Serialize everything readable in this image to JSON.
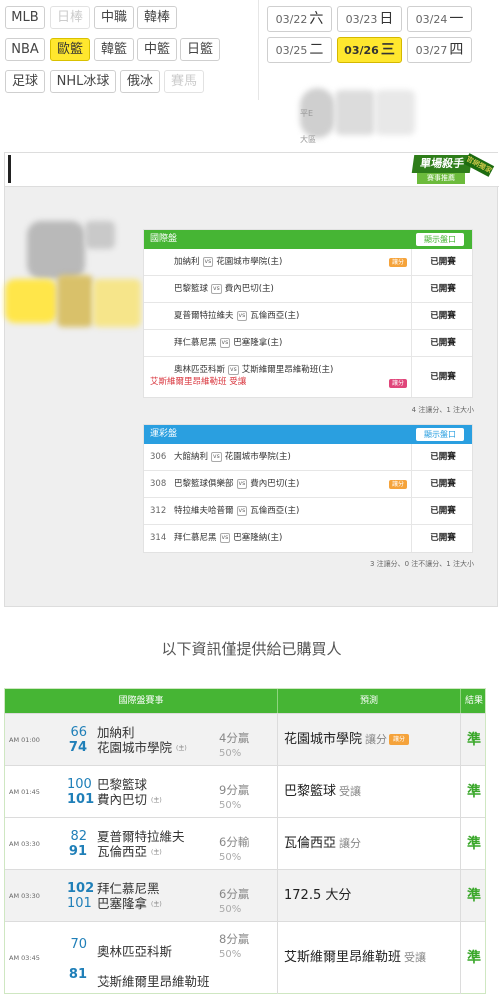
{
  "league_tabs": [
    {
      "label": "MLB",
      "state": "normal"
    },
    {
      "label": "日棒",
      "state": "disabled"
    },
    {
      "label": "中職",
      "state": "normal"
    },
    {
      "label": "韓棒",
      "state": "normal"
    },
    {
      "label": "NBA",
      "state": "normal"
    },
    {
      "label": "歐籃",
      "state": "selected"
    },
    {
      "label": "韓籃",
      "state": "normal"
    },
    {
      "label": "中籃",
      "state": "normal"
    },
    {
      "label": "日籃",
      "state": "normal"
    },
    {
      "label": "足球",
      "state": "normal"
    },
    {
      "label": "NHL冰球",
      "state": "normal"
    },
    {
      "label": "俄冰",
      "state": "normal"
    },
    {
      "label": "賽馬",
      "state": "disabled"
    }
  ],
  "dates": [
    {
      "md": "03/22",
      "dow": "六",
      "selected": false
    },
    {
      "md": "03/23",
      "dow": "日",
      "selected": false
    },
    {
      "md": "03/24",
      "dow": "一",
      "selected": false
    },
    {
      "md": "03/25",
      "dow": "二",
      "selected": false
    },
    {
      "md": "03/26",
      "dow": "三",
      "selected": true
    },
    {
      "md": "03/27",
      "dow": "四",
      "selected": false
    }
  ],
  "blurred_top": {
    "line1": "平E",
    "line2": "大區"
  },
  "banner": {
    "badge_main": "單場殺手",
    "badge_sub": "賽事推薦",
    "badge_ribbon": "官網獨家",
    "intl": {
      "title": "國際盤",
      "button": "顯示盤口",
      "rows": [
        {
          "away": "加納利",
          "home": "花園城市學院(主)",
          "tag": "讓分",
          "status": "已開賽"
        },
        {
          "away": "巴黎籃球",
          "home": "費內巴切(主)",
          "tag": "",
          "status": "已開賽"
        },
        {
          "away": "夏普爾特拉維夫",
          "home": "瓦倫西亞(主)",
          "tag": "",
          "status": "已開賽"
        },
        {
          "away": "拜仁慕尼黑",
          "home": "巴塞隆拿(主)",
          "tag": "",
          "status": "已開賽"
        },
        {
          "away": "奧林匹亞科斯",
          "home": "艾斯維爾里昂維勒班(主)",
          "extra": "艾斯維爾里昂維勒班 受讓",
          "tag": "讓分",
          "status": "已開賽"
        }
      ],
      "note": "4 注讓分、1 注大小"
    },
    "lottery": {
      "title": "運彩盤",
      "button": "顯示盤口",
      "rows": [
        {
          "num": "306",
          "away": "大館納利",
          "home": "花園城市學院(主)",
          "tag": "",
          "status": "已開賽"
        },
        {
          "num": "308",
          "away": "巴黎籃球俱樂部",
          "home": "費內巴切(主)",
          "tag": "讓分",
          "status": "已開賽"
        },
        {
          "num": "312",
          "away": "特拉維夫哈普爾",
          "home": "瓦倫西亞(主)",
          "tag": "",
          "status": "已開賽"
        },
        {
          "num": "314",
          "away": "拜仁慕尼黑",
          "home": "巴塞隆納(主)",
          "tag": "",
          "status": "已開賽"
        }
      ],
      "note": "3 注讓分、0 注不讓分、1 注大小"
    }
  },
  "notice": "以下資訊僅提供給已購買人",
  "table": {
    "headers": {
      "match": "國際盤賽事",
      "prediction": "預測",
      "result": "結果"
    },
    "home_mark": "(主)",
    "rows": [
      {
        "time": "AM 01:00",
        "away_num": "66",
        "home_num": "74",
        "away": "加納利",
        "home": "花園城市學院",
        "res": "4分贏",
        "pct": "50%",
        "pick": "花園城市學院",
        "pick_sub": "讓分",
        "pick_tag": "讓分",
        "outcome": "準"
      },
      {
        "time": "AM 01:45",
        "away_num": "100",
        "home_num": "101",
        "away": "巴黎籃球",
        "home": "費內巴切",
        "res": "9分贏",
        "pct": "50%",
        "pick": "巴黎籃球",
        "pick_sub": "受讓",
        "pick_tag": "",
        "outcome": "準"
      },
      {
        "time": "AM 03:30",
        "away_num": "82",
        "home_num": "91",
        "away": "夏普爾特拉維夫",
        "home": "瓦倫西亞",
        "res": "6分輸",
        "pct": "50%",
        "pick": "瓦倫西亞",
        "pick_sub": "讓分",
        "pick_tag": "",
        "outcome": "準"
      },
      {
        "time": "AM 03:30",
        "away_num": "102",
        "home_num": "101",
        "away": "拜仁慕尼黑",
        "home": "巴塞隆拿",
        "res": "6分贏",
        "pct": "50%",
        "pick": "172.5 大分",
        "pick_sub": "",
        "pick_tag": "",
        "outcome": "準"
      },
      {
        "time": "AM 03:45",
        "away_num": "70",
        "home_num": "81",
        "away": "奧林匹亞科斯",
        "home": "艾斯維爾里昂維勒班",
        "res": "8分贏",
        "pct": "50%",
        "pick": "艾斯維爾里昂維勒班",
        "pick_sub": "受讓",
        "pick_tag": "",
        "outcome": "準"
      }
    ]
  },
  "colors": {
    "selected": "#ffe72e",
    "green": "#46b534",
    "blue": "#2a9fe0",
    "result": "#3aa72a"
  }
}
